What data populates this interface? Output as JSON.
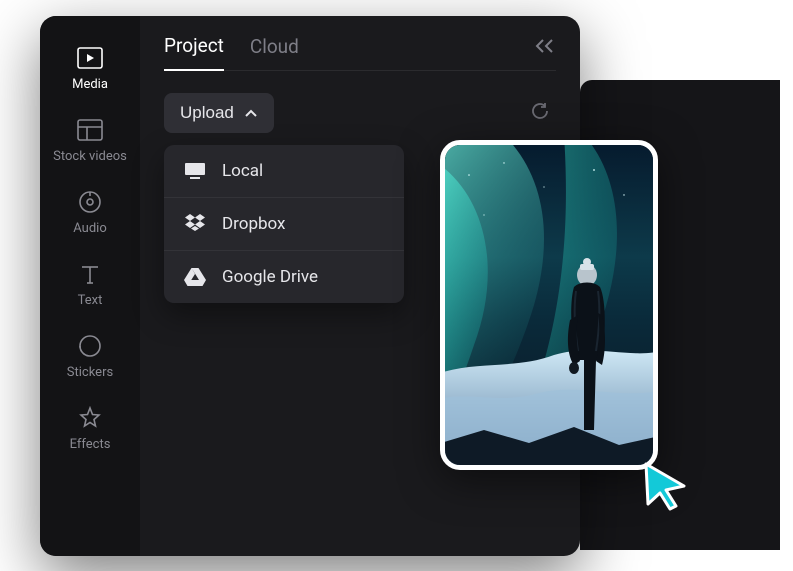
{
  "sidebar": {
    "items": [
      {
        "label": "Media",
        "icon": "media-icon",
        "active": true
      },
      {
        "label": "Stock videos",
        "icon": "stock-videos-icon",
        "active": false
      },
      {
        "label": "Audio",
        "icon": "audio-icon",
        "active": false
      },
      {
        "label": "Text",
        "icon": "text-icon",
        "active": false
      },
      {
        "label": "Stickers",
        "icon": "stickers-icon",
        "active": false
      },
      {
        "label": "Effects",
        "icon": "effects-icon",
        "active": false
      }
    ]
  },
  "tabs": {
    "items": [
      {
        "label": "Project",
        "active": true
      },
      {
        "label": "Cloud",
        "active": false
      }
    ]
  },
  "upload": {
    "button_label": "Upload",
    "menu": [
      {
        "label": "Local",
        "icon": "monitor-icon"
      },
      {
        "label": "Dropbox",
        "icon": "dropbox-icon"
      },
      {
        "label": "Google Drive",
        "icon": "google-drive-icon"
      }
    ]
  },
  "thumbnail": {
    "description": "Person in winter coat and beanie viewing aurora borealis over snowy mountains"
  },
  "colors": {
    "accent": "#13c9d8",
    "panel": "#1a1a1d",
    "sidebar": "#131315",
    "menu": "#27272c"
  }
}
